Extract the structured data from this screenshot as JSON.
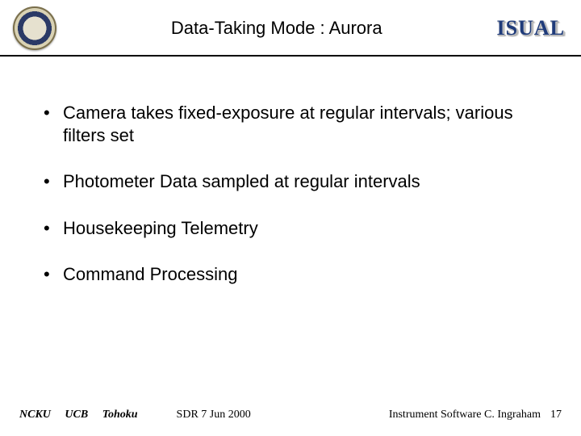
{
  "header": {
    "title": "Data-Taking Mode : Aurora",
    "brand": "ISUAL"
  },
  "bullets": [
    "Camera takes fixed-exposure at regular intervals; various filters set",
    "Photometer Data sampled at regular intervals",
    "Housekeeping Telemetry",
    "Command Processing"
  ],
  "footer": {
    "orgs": [
      "NCKU",
      "UCB",
      "Tohoku"
    ],
    "event": "SDR 7 Jun 2000",
    "credit": "Instrument Software   C. Ingraham",
    "page": "17"
  }
}
